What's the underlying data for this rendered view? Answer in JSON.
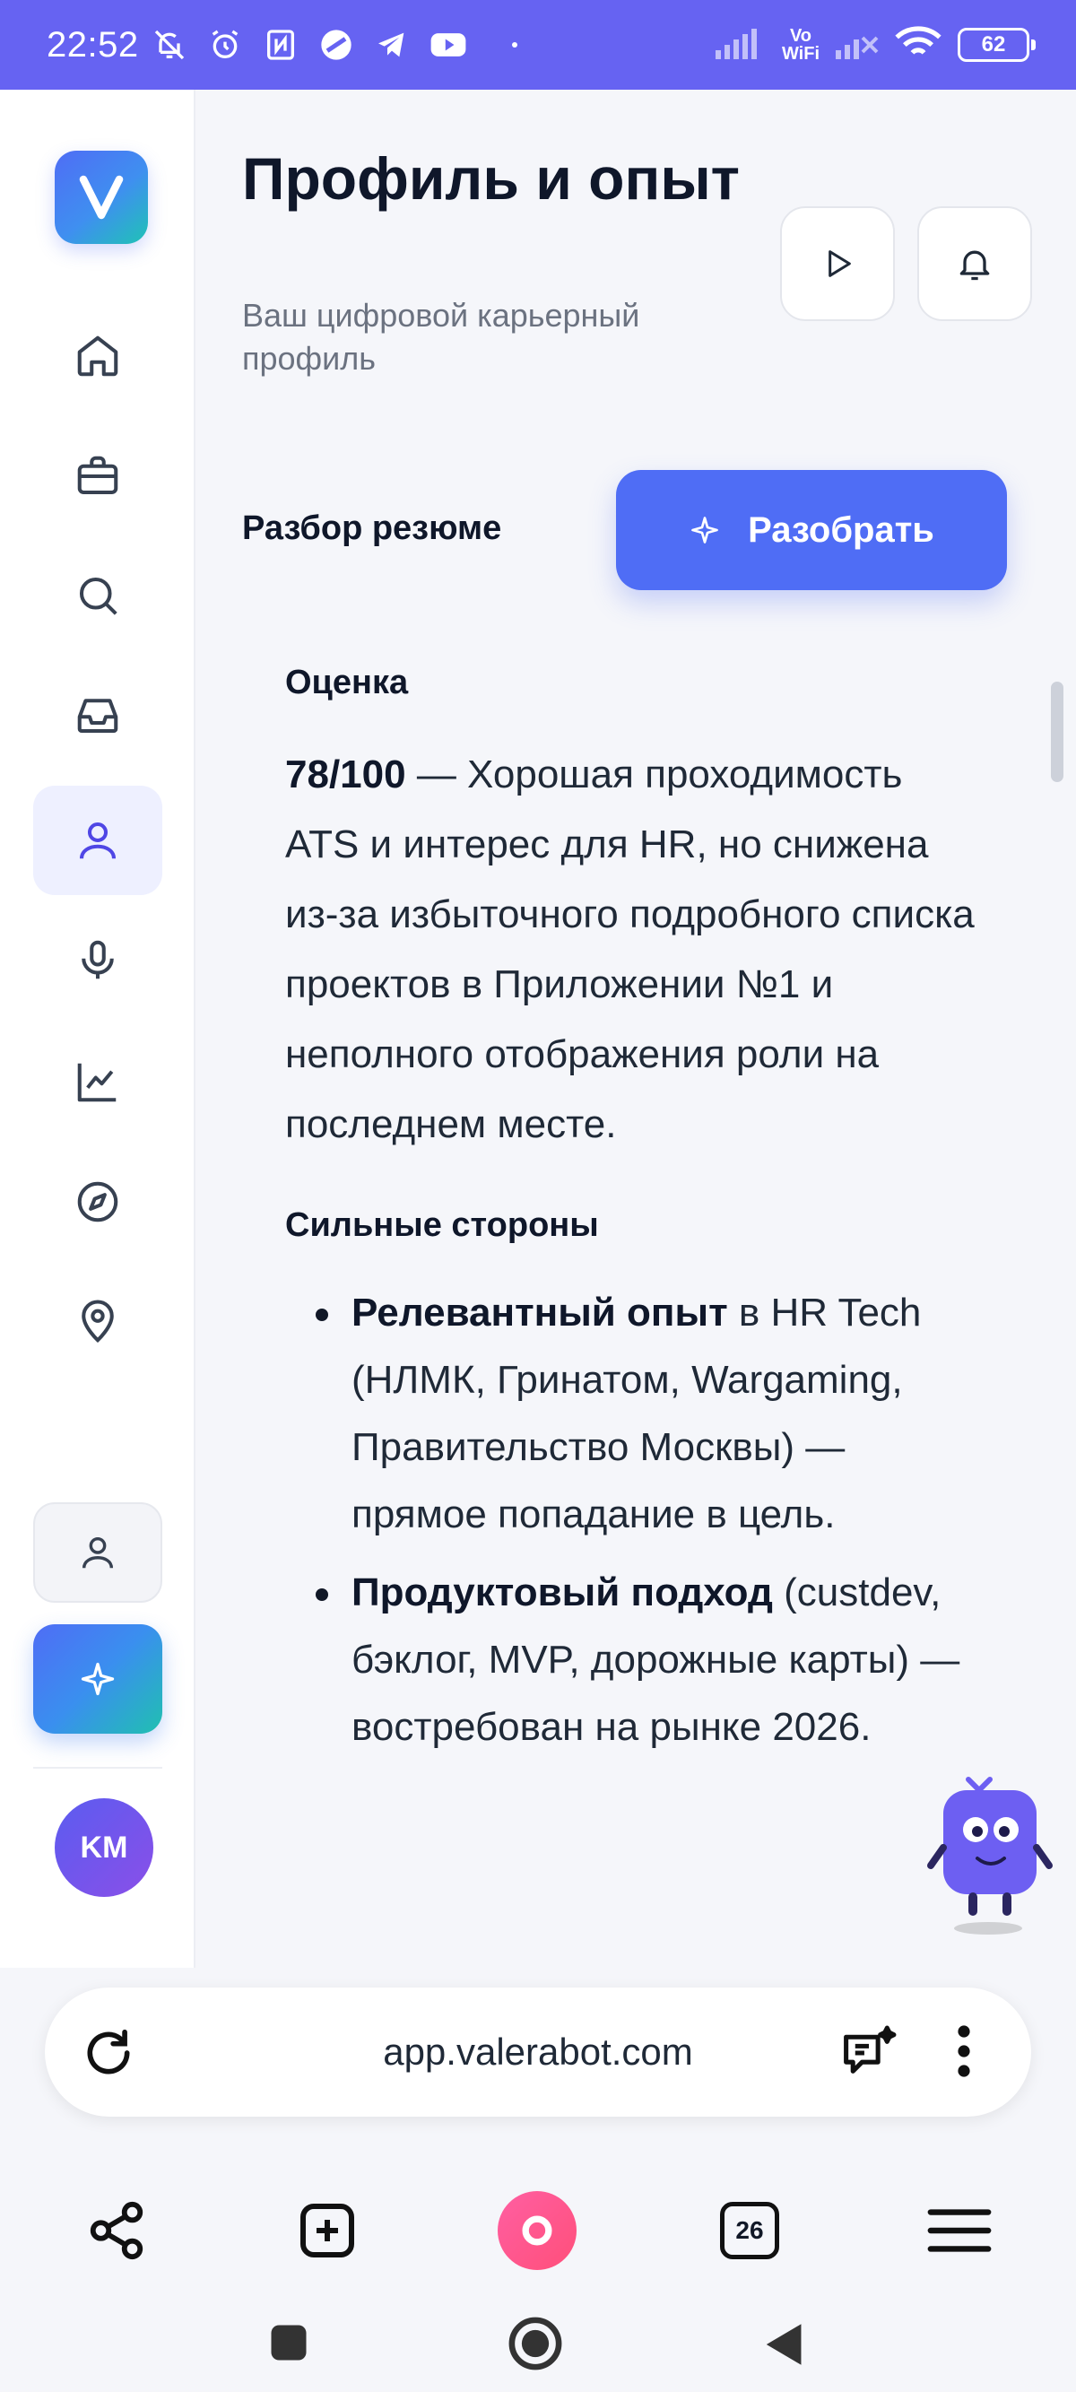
{
  "status_bar": {
    "time": "22:52",
    "network": "Vo\nWiFi",
    "battery": "62"
  },
  "sidebar": {
    "logo_letter": "V",
    "items": [
      {
        "name": "home"
      },
      {
        "name": "jobs"
      },
      {
        "name": "search"
      },
      {
        "name": "inbox"
      },
      {
        "name": "profile",
        "active": true
      },
      {
        "name": "interview"
      },
      {
        "name": "analytics"
      },
      {
        "name": "explore"
      },
      {
        "name": "location"
      }
    ],
    "avatar_initials": "KM"
  },
  "header": {
    "title": "Профиль и опыт",
    "subtitle": "Ваш цифровой карьерный профиль"
  },
  "resume": {
    "section_label": "Разбор резюме",
    "analyze_button": "Разобрать"
  },
  "review": {
    "score_heading": "Оценка",
    "score": "78/100",
    "score_text": "— Хорошая проходимость ATS и интерес для HR, но снижена из-за избыточного подробного списка проектов в Приложении №1 и неполного отображения роли на последнем месте.",
    "strengths_heading": "Сильные стороны",
    "strengths": [
      {
        "bold": "Релевантный опыт",
        "text": " в HR Tech (НЛМК, Гринатом, Wargaming, Правительство Москвы) — прямое попадание в цель."
      },
      {
        "bold": "Продуктовый подход",
        "text": " (custdev, бэклог, MVP, дорожные карты) — востребован на рынке 2026."
      }
    ]
  },
  "browser": {
    "url": "app.valerabot.com",
    "tabs_count": "26"
  },
  "colors": {
    "accent": "#4f6df5",
    "status_bar": "#6663f2",
    "alice": "#ff4f7a"
  }
}
